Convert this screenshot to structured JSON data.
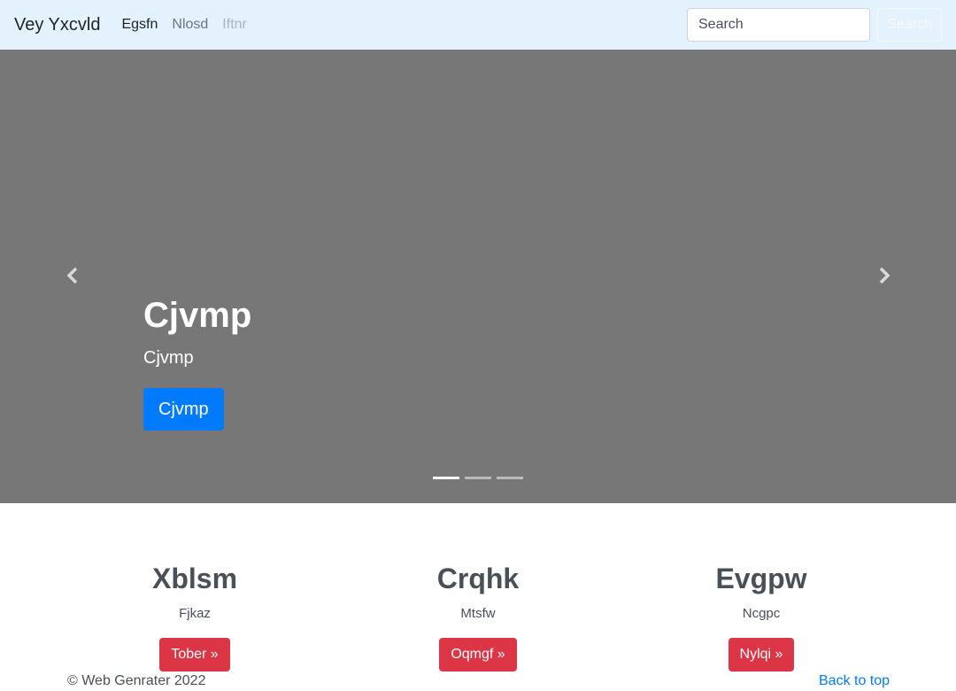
{
  "navbar": {
    "brand": "Vey Yxcvld",
    "links": [
      {
        "label": "Egsfn",
        "state": "active"
      },
      {
        "label": "Nlosd",
        "state": "normal"
      },
      {
        "label": "Iftnr",
        "state": "disabled"
      }
    ],
    "search_placeholder": "Search",
    "search_button": "Search",
    "background": "#e3f2fd"
  },
  "carousel": {
    "background": "#777777",
    "prev_icon": "chevron-left-icon",
    "next_icon": "chevron-right-icon",
    "caption": {
      "title": "Cjvmp",
      "text": "Cjvmp",
      "button": "Cjvmp"
    },
    "indicators": [
      {
        "active": true
      },
      {
        "active": false
      },
      {
        "active": false
      }
    ]
  },
  "features": [
    {
      "title": "Xblsm",
      "text": "Fjkaz",
      "button": "Tober »"
    },
    {
      "title": "Crqhk",
      "text": "Mtsfw",
      "button": "Oqmgf »"
    },
    {
      "title": "Evgpw",
      "text": "Ncgpc",
      "button": "Nylqi »"
    }
  ],
  "footer": {
    "copyright": "© Web Genrater 2022",
    "back_to_top": "Back to top"
  },
  "colors": {
    "primary": "#007bff",
    "danger": "#dc3545"
  }
}
